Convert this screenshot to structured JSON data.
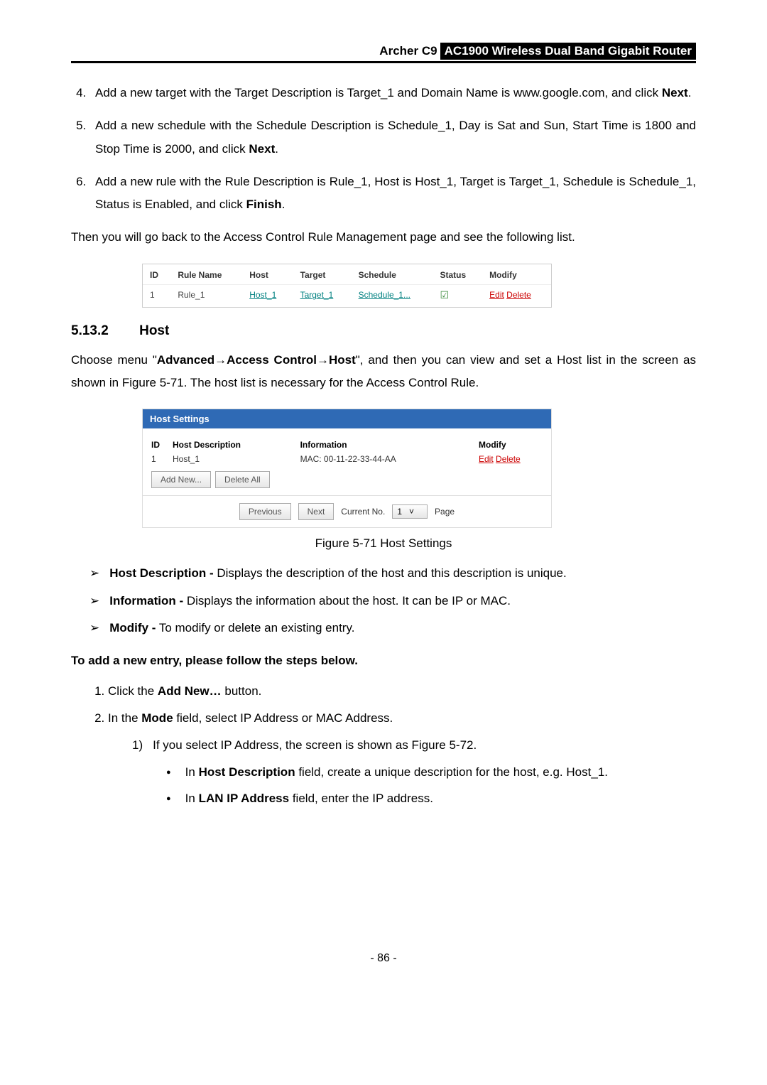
{
  "header": {
    "model": "Archer C9",
    "title": "AC1900 Wireless Dual Band Gigabit Router"
  },
  "steps_top": [
    {
      "pre": "Add a new target with the Target Description is Target_1 and Domain Name is www.google.com, and click ",
      "bold": "Next",
      "post": "."
    },
    {
      "pre": "Add a new schedule with the Schedule Description is Schedule_1, Day is Sat and Sun, Start Time is 1800 and Stop Time is 2000, and click ",
      "bold": "Next",
      "post": "."
    },
    {
      "pre": "Add a new rule with the Rule Description is Rule_1, Host is Host_1, Target is Target_1, Schedule is Schedule_1, Status is Enabled, and click ",
      "bold": "Finish",
      "post": "."
    }
  ],
  "return_text": "Then you will go back to the Access Control Rule Management page and see the following list.",
  "rule_table": {
    "headers": [
      "ID",
      "Rule Name",
      "Host",
      "Target",
      "Schedule",
      "Status",
      "Modify"
    ],
    "row": {
      "id": "1",
      "name": "Rule_1",
      "host": "Host_1",
      "target": "Target_1",
      "schedule": "Schedule_1...",
      "status": "☑",
      "edit": "Edit",
      "delete": "Delete"
    }
  },
  "section": {
    "number": "5.13.2",
    "title": "Host"
  },
  "section_intro": {
    "part1": "Choose menu \"",
    "bold": "Advanced→Access Control→Host",
    "part2": "\", and then you can view and set a Host list in the screen as shown in Figure 5-71. The host list is necessary for the Access Control Rule."
  },
  "host_widget": {
    "title": "Host Settings",
    "headers": {
      "id": "ID",
      "desc": "Host Description",
      "info": "Information",
      "mod": "Modify"
    },
    "row": {
      "id": "1",
      "desc": "Host_1",
      "info": "MAC: 00-11-22-33-44-AA",
      "edit": "Edit",
      "delete": "Delete"
    },
    "buttons": {
      "add": "Add New...",
      "delall": "Delete All"
    },
    "pager": {
      "prev": "Previous",
      "next": "Next",
      "currno": "Current No.",
      "val": "1",
      "page": "Page"
    }
  },
  "fig_caption": "Figure 5-71 Host Settings",
  "field_desc": [
    {
      "bold": "Host Description -",
      "text": " Displays the description of the host and this description is unique."
    },
    {
      "bold": "Information -",
      "text": " Displays the information about the host. It can be IP or MAC."
    },
    {
      "bold": "Modify -",
      "text": " To modify or delete an existing entry."
    }
  ],
  "add_entry_title": "To add a new entry, please follow the steps below.",
  "add_steps": {
    "s1": {
      "pre": "Click the ",
      "bold": "Add New…",
      "post": " button."
    },
    "s2": {
      "pre": "In the ",
      "bold": "Mode",
      "post": " field, select IP Address or MAC Address."
    },
    "s2_1": "If you select IP Address, the screen is shown as Figure 5-72.",
    "s2_1_b1": {
      "pre": "In ",
      "bold": "Host Description",
      "post": " field, create a unique description for the host, e.g. Host_1."
    },
    "s2_1_b2": {
      "pre": "In ",
      "bold": "LAN IP Address",
      "post": " field, enter the IP address."
    }
  },
  "page_number": "- 86 -"
}
